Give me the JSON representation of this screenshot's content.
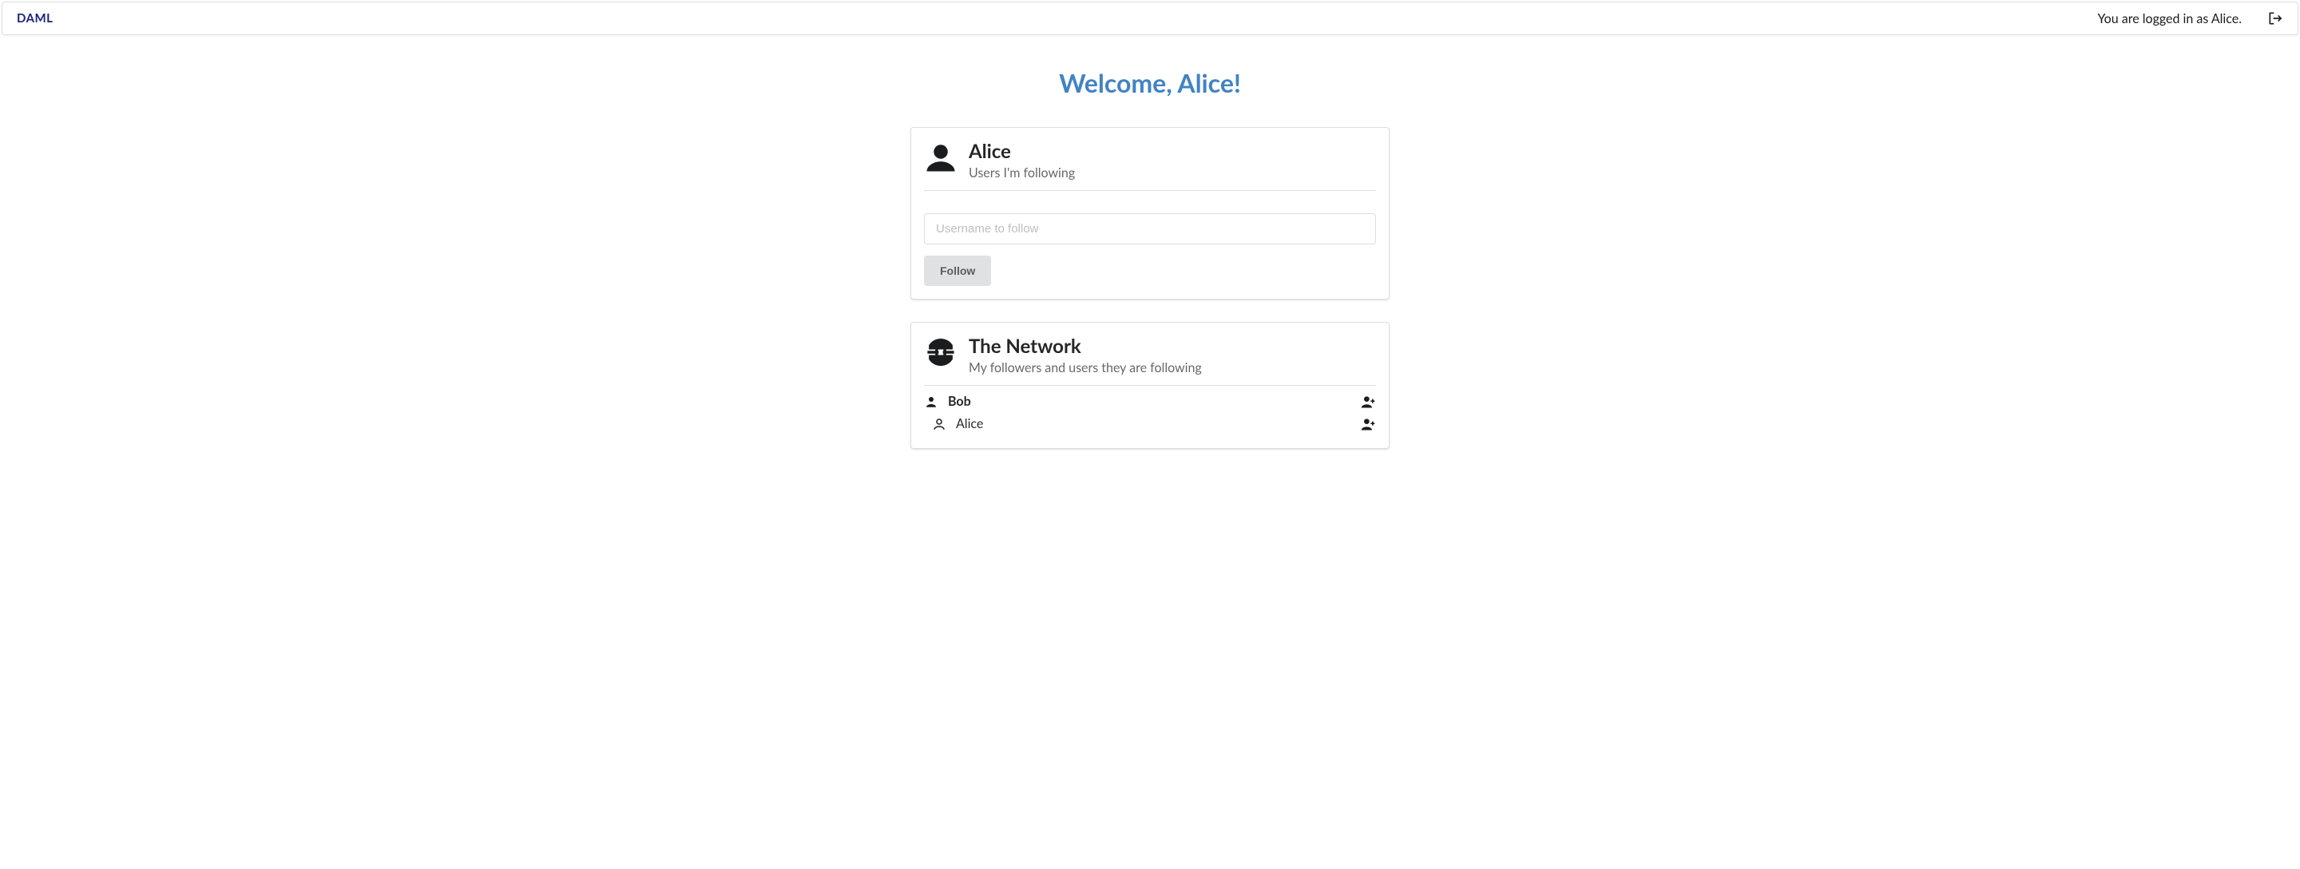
{
  "header": {
    "logo": "DAML",
    "login_status": "You are logged in as Alice."
  },
  "welcome": "Welcome, Alice!",
  "following_card": {
    "title": "Alice",
    "subtitle": "Users I'm following",
    "input_placeholder": "Username to follow",
    "follow_button": "Follow"
  },
  "network_card": {
    "title": "The Network",
    "subtitle": "My followers and users they are following",
    "rows": [
      {
        "name": "Bob",
        "indent": false,
        "outline": false
      },
      {
        "name": "Alice",
        "indent": true,
        "outline": true
      }
    ]
  }
}
